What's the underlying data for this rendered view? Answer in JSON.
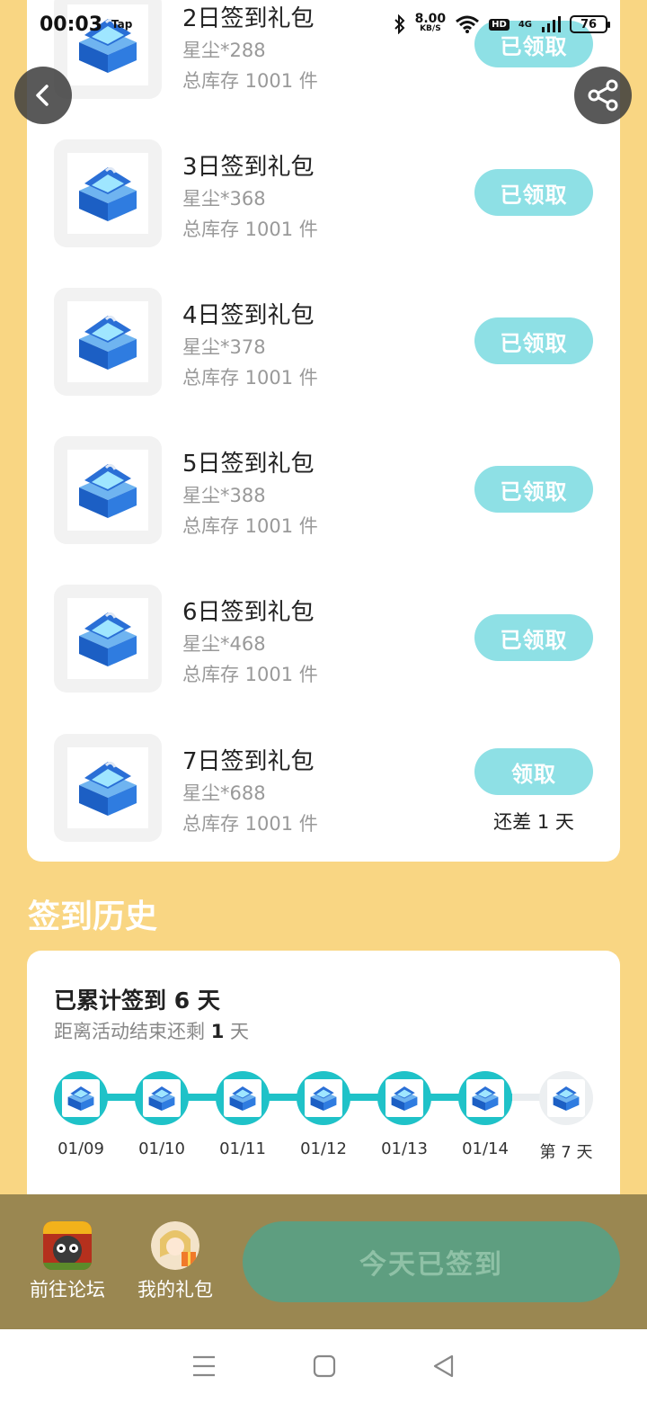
{
  "status_bar": {
    "time": "00:03",
    "app_tag": "Tap",
    "net_speed_value": "8.00",
    "net_speed_unit": "KB/S",
    "hd": "HD",
    "signal": "4G",
    "battery": "76"
  },
  "gifts": [
    {
      "title": "2日签到礼包",
      "reward": "星尘*288",
      "stock": "总库存 1001 件",
      "button": "已领取"
    },
    {
      "title": "3日签到礼包",
      "reward": "星尘*368",
      "stock": "总库存 1001 件",
      "button": "已领取"
    },
    {
      "title": "4日签到礼包",
      "reward": "星尘*378",
      "stock": "总库存 1001 件",
      "button": "已领取"
    },
    {
      "title": "5日签到礼包",
      "reward": "星尘*388",
      "stock": "总库存 1001 件",
      "button": "已领取"
    },
    {
      "title": "6日签到礼包",
      "reward": "星尘*468",
      "stock": "总库存 1001 件",
      "button": "已领取"
    },
    {
      "title": "7日签到礼包",
      "reward": "星尘*688",
      "stock": "总库存 1001 件",
      "button": "领取",
      "note": "还差 1 天"
    }
  ],
  "history": {
    "title": "签到历史",
    "count_prefix": "已累计签到 ",
    "count_value": "6",
    "count_suffix": " 天",
    "remain_prefix": "距离活动结束还剩 ",
    "remain_value": "1",
    "remain_suffix": " 天",
    "timeline": [
      "01/09",
      "01/10",
      "01/11",
      "01/12",
      "01/13",
      "01/14",
      "第 7 天"
    ]
  },
  "bottom": {
    "forum_label": "前往论坛",
    "gifts_label": "我的礼包",
    "signed_label": "今天已签到"
  },
  "colors": {
    "background": "#f9d683",
    "accent_teal": "#1fc2c8",
    "button_light_teal": "#8ee0e5",
    "bottom_bar": "#9a8751",
    "signed_button": "#5e9e80"
  }
}
